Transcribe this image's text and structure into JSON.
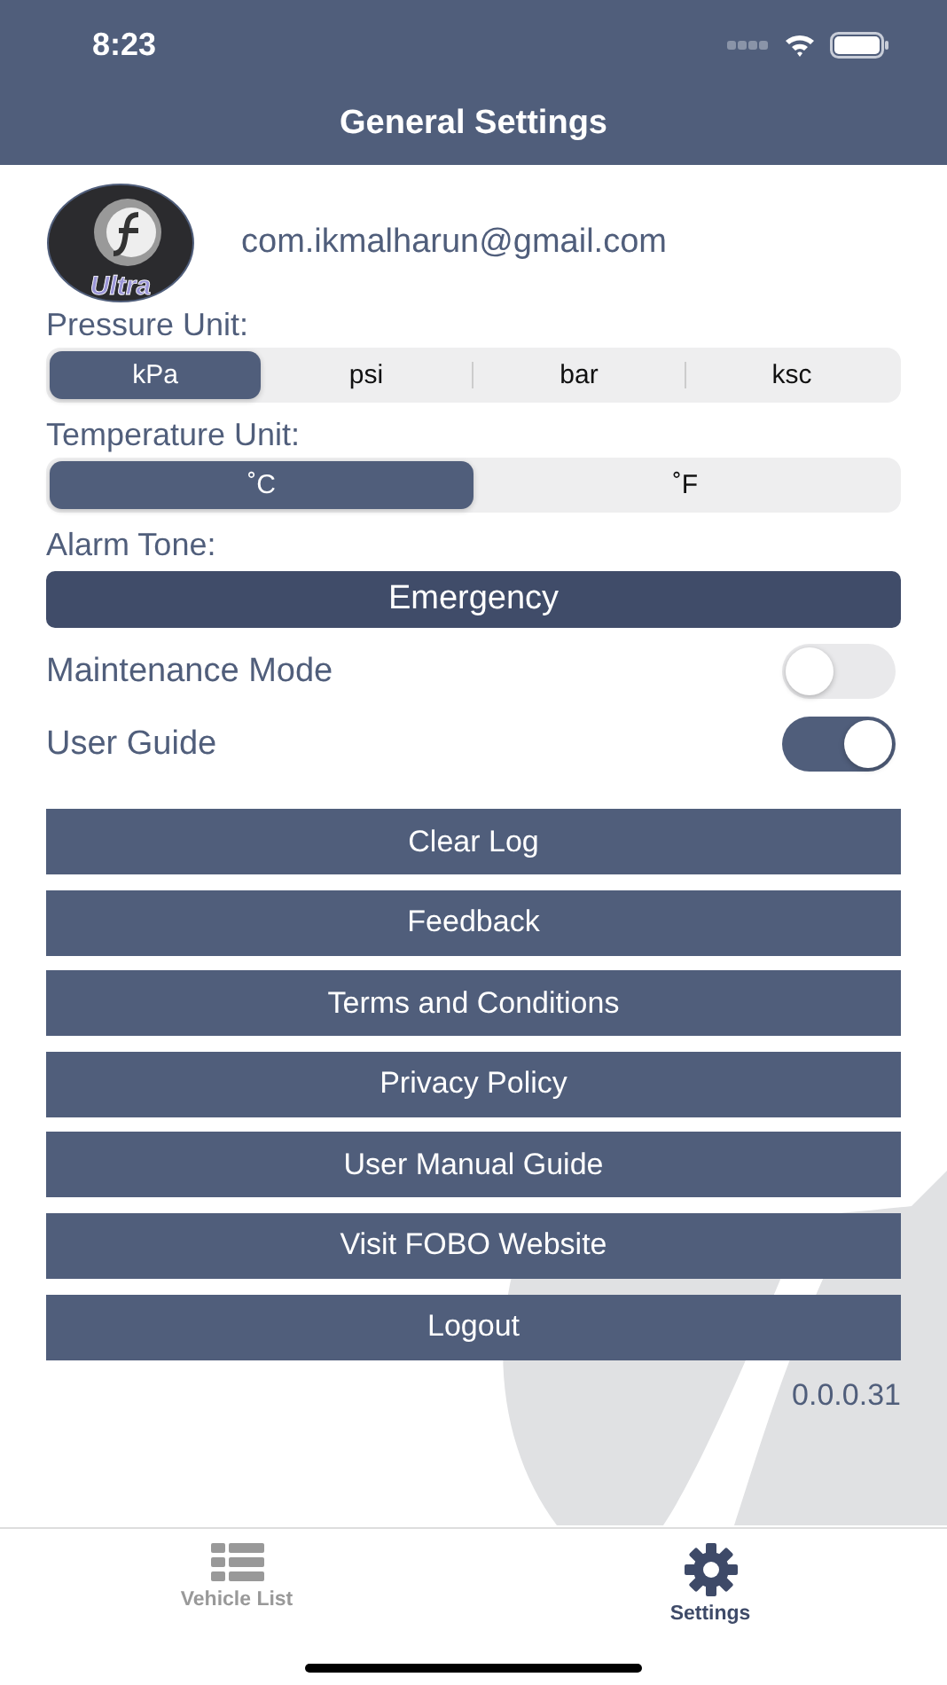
{
  "status_bar": {
    "time": "8:23"
  },
  "header": {
    "title": "General Settings"
  },
  "account": {
    "logo_text": "Ultra",
    "email": "com.ikmalharun@gmail.com"
  },
  "pressure_unit": {
    "label": "Pressure Unit:",
    "options": [
      {
        "label": "kPa",
        "selected": true
      },
      {
        "label": "psi",
        "selected": false
      },
      {
        "label": "bar",
        "selected": false
      },
      {
        "label": "ksc",
        "selected": false
      }
    ]
  },
  "temperature_unit": {
    "label": "Temperature Unit:",
    "options": [
      {
        "label": "˚C",
        "selected": true
      },
      {
        "label": "˚F",
        "selected": false
      }
    ]
  },
  "alarm_tone": {
    "label": "Alarm Tone:",
    "value": "Emergency"
  },
  "toggles": [
    {
      "label": "Maintenance Mode",
      "on": false
    },
    {
      "label": "User Guide",
      "on": true
    }
  ],
  "buttons": [
    "Clear Log",
    "Feedback",
    "Terms and Conditions",
    "Privacy Policy",
    "User Manual Guide",
    "Visit FOBO Website",
    "Logout"
  ],
  "version": "0.0.0.31",
  "tab_bar": [
    {
      "label": "Vehicle List",
      "kind": "list",
      "selected": false
    },
    {
      "label": "Settings",
      "kind": "gear",
      "selected": true
    }
  ]
}
